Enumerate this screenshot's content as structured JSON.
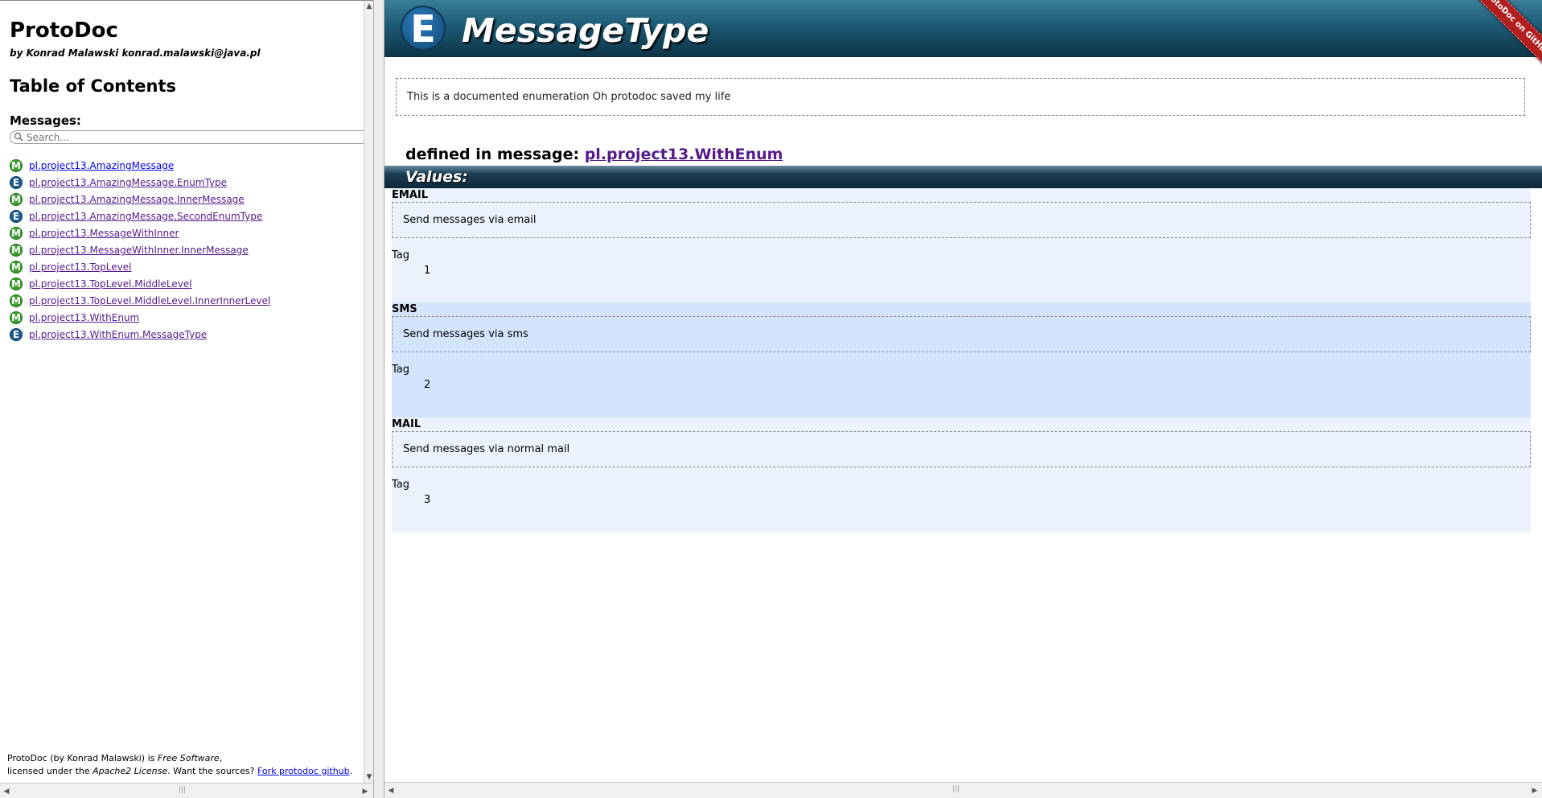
{
  "sidebar": {
    "title": "ProtoDoc",
    "byline": "by Konrad Malawski konrad.malawski@java.pl",
    "toc_title": "Table of Contents",
    "messages_label": "Messages:",
    "search_placeholder": "Search...",
    "items": [
      {
        "kind": "M",
        "label": "pl.project13.AmazingMessage"
      },
      {
        "kind": "E",
        "label": "pl.project13.AmazingMessage.EnumType"
      },
      {
        "kind": "M",
        "label": "pl.project13.AmazingMessage.InnerMessage"
      },
      {
        "kind": "E",
        "label": "pl.project13.AmazingMessage.SecondEnumType"
      },
      {
        "kind": "M",
        "label": "pl.project13.MessageWithInner"
      },
      {
        "kind": "M",
        "label": "pl.project13.MessageWithInner.InnerMessage"
      },
      {
        "kind": "M",
        "label": "pl.project13.TopLevel"
      },
      {
        "kind": "M",
        "label": "pl.project13.TopLevel.MiddleLevel"
      },
      {
        "kind": "M",
        "label": "pl.project13.TopLevel.MiddleLevel.InnerInnerLevel"
      },
      {
        "kind": "M",
        "label": "pl.project13.WithEnum"
      },
      {
        "kind": "E",
        "label": "pl.project13.WithEnum.MessageType"
      }
    ],
    "footer": {
      "line1_pre": "ProtoDoc (by Konrad Malawski) is ",
      "line1_em": "Free Software",
      "line1_post": ",",
      "line2_pre": "licensed under the ",
      "line2_em": "Apache2 License",
      "line2_post": ". Want the sources? ",
      "fork_link": "Fork protodoc github",
      "line2_end": "."
    }
  },
  "main": {
    "badge": "E",
    "title": "MessageType",
    "ribbon": "ProtoDoc on GitHub",
    "description": "This is a documented enumeration Oh protodoc saved my life",
    "defined_in_label": "defined in message: ",
    "defined_in_link": "pl.project13.WithEnum",
    "values_header": "Values:",
    "tag_label": "Tag",
    "values": [
      {
        "name": "EMAIL",
        "description": "Send messages via email",
        "tag": "1"
      },
      {
        "name": "SMS",
        "description": "Send messages via sms",
        "tag": "2"
      },
      {
        "name": "MAIL",
        "description": "Send messages via normal mail",
        "tag": "3"
      }
    ]
  },
  "colors": {
    "message_badge": "#3a9a2f",
    "enum_badge": "#1c5a8c",
    "header_dark": "#0d3446",
    "row_odd": "#ebf2fe",
    "row_even": "#d4e4fc",
    "ribbon": "#b01e1e"
  }
}
